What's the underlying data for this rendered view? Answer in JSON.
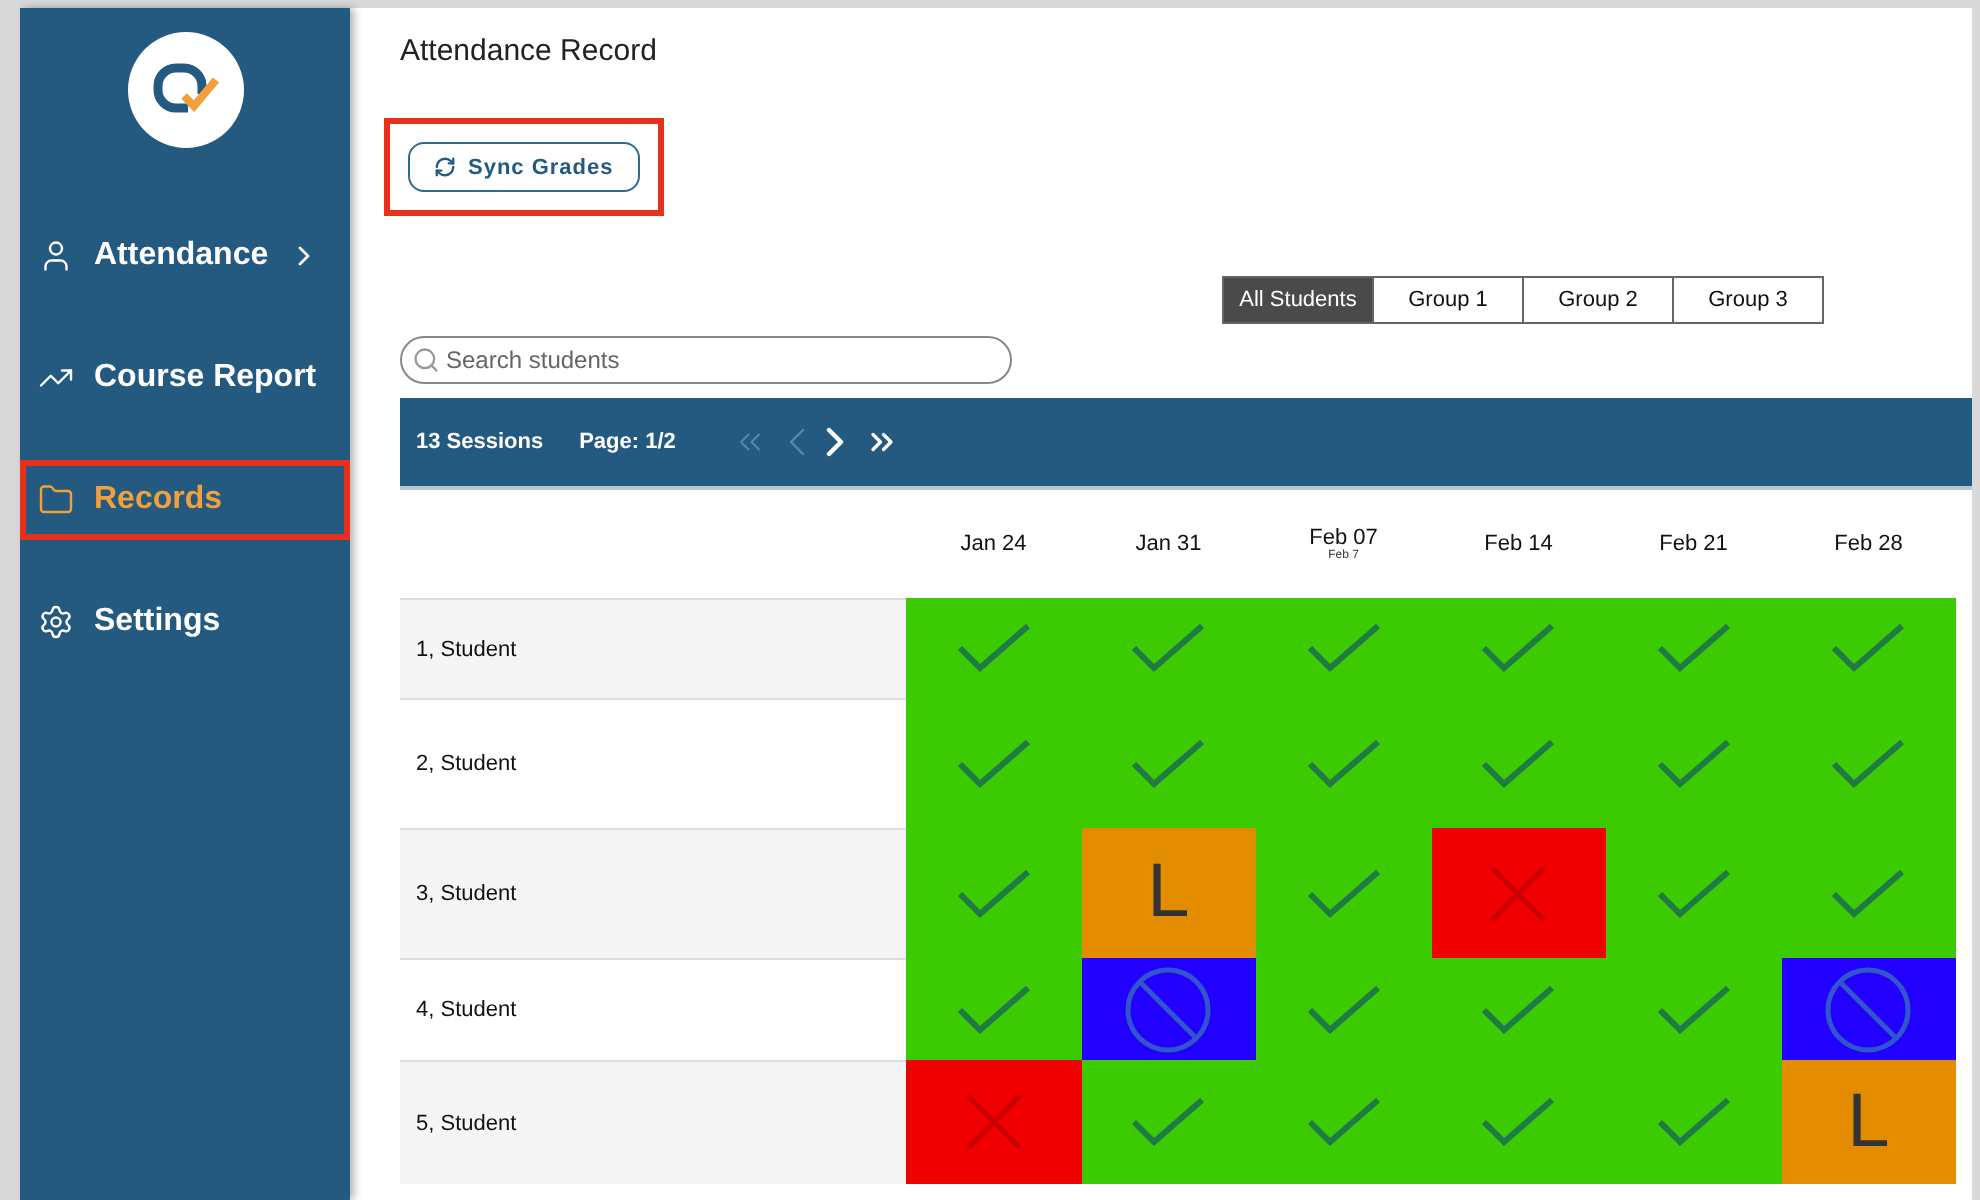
{
  "sidebar": {
    "items": [
      {
        "label": "Attendance",
        "has_submenu": true,
        "selected": false,
        "highlighted": false
      },
      {
        "label": "Course Report",
        "has_submenu": false,
        "selected": false,
        "highlighted": false
      },
      {
        "label": "Records",
        "has_submenu": false,
        "selected": true,
        "highlighted": true
      },
      {
        "label": "Settings",
        "has_submenu": false,
        "selected": false,
        "highlighted": false
      }
    ]
  },
  "page_title": "Attendance Record",
  "sync_button": {
    "label": "Sync Grades",
    "highlighted": true
  },
  "group_tabs": [
    {
      "label": "All Students",
      "selected": true
    },
    {
      "label": "Group 1",
      "selected": false
    },
    {
      "label": "Group 2",
      "selected": false
    },
    {
      "label": "Group 3",
      "selected": false
    }
  ],
  "search": {
    "placeholder": "Search students"
  },
  "toolbar": {
    "sessions": "13 Sessions",
    "page": "Page: 1/2",
    "first_disabled": true,
    "prev_disabled": true,
    "next_disabled": false,
    "last_disabled": false
  },
  "columns": [
    {
      "date": "Jan 24"
    },
    {
      "date": "Jan 31"
    },
    {
      "date": "Feb 07",
      "subtitle": "Feb 7"
    },
    {
      "date": "Feb 14"
    },
    {
      "date": "Feb 21"
    },
    {
      "date": "Feb 28"
    }
  ],
  "rows": [
    {
      "name": "1, Student",
      "cells": [
        {
          "kind": "present"
        },
        {
          "kind": "present"
        },
        {
          "kind": "present"
        },
        {
          "kind": "present"
        },
        {
          "kind": "present"
        },
        {
          "kind": "present"
        }
      ]
    },
    {
      "name": "2, Student",
      "cells": [
        {
          "kind": "present"
        },
        {
          "kind": "present"
        },
        {
          "kind": "present"
        },
        {
          "kind": "present"
        },
        {
          "kind": "present"
        },
        {
          "kind": "present"
        }
      ]
    },
    {
      "name": "3, Student",
      "cells": [
        {
          "kind": "present"
        },
        {
          "kind": "late",
          "text": "L"
        },
        {
          "kind": "present"
        },
        {
          "kind": "absent"
        },
        {
          "kind": "present"
        },
        {
          "kind": "present"
        }
      ]
    },
    {
      "name": "4, Student",
      "cells": [
        {
          "kind": "present"
        },
        {
          "kind": "excused"
        },
        {
          "kind": "present"
        },
        {
          "kind": "present"
        },
        {
          "kind": "present"
        },
        {
          "kind": "excused"
        }
      ]
    },
    {
      "name": "5, Student",
      "cells": [
        {
          "kind": "absent"
        },
        {
          "kind": "present"
        },
        {
          "kind": "present"
        },
        {
          "kind": "present"
        },
        {
          "kind": "present"
        },
        {
          "kind": "late",
          "text": "L"
        }
      ]
    }
  ]
}
